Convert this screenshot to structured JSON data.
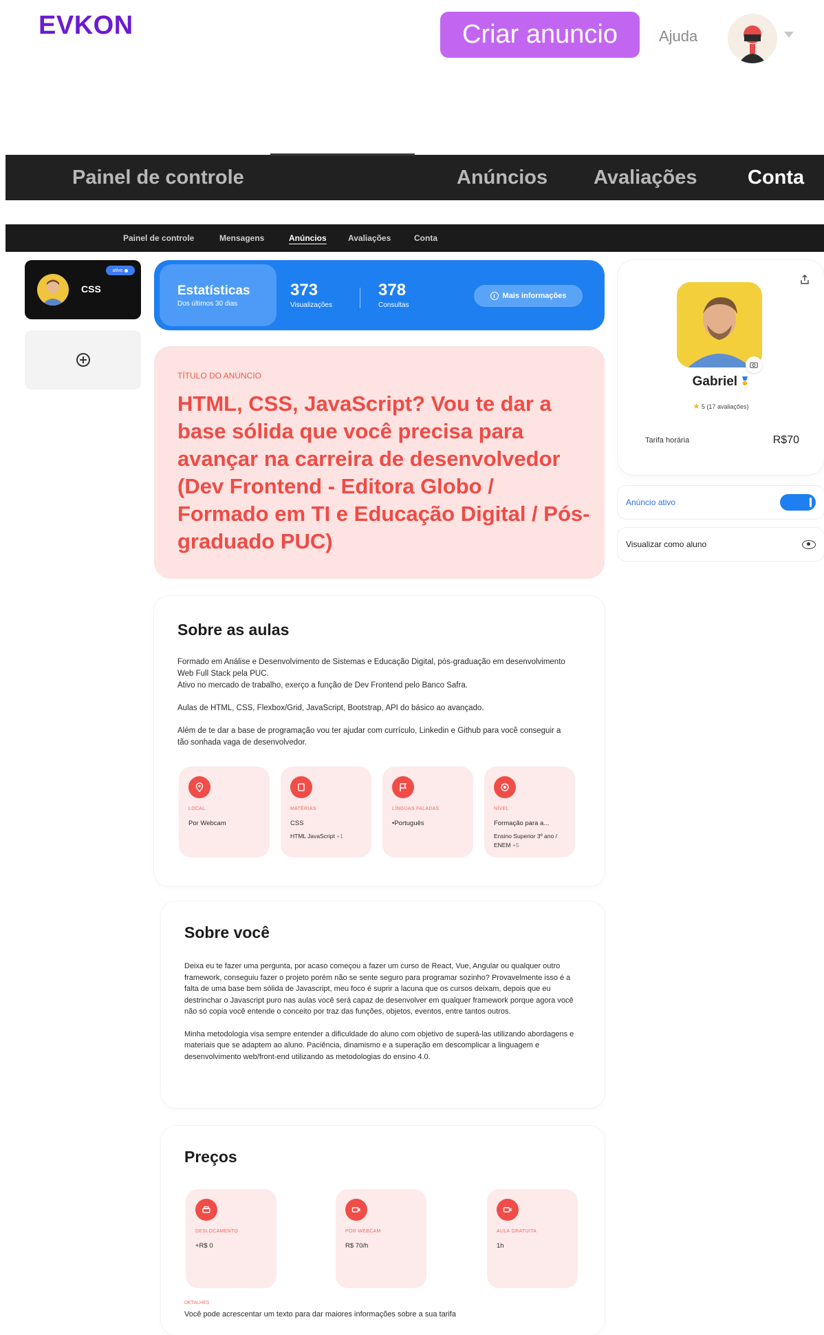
{
  "header": {
    "logo": "EVKON",
    "create_ad": "Criar anuncio",
    "help": "Ajuda"
  },
  "main_nav": {
    "items": [
      "Painel de controle",
      "Anúncios",
      "Avaliações",
      "Conta"
    ],
    "active": "Conta"
  },
  "sub_nav": {
    "items": [
      "Painel de controle",
      "Mensagens",
      "Anúncios",
      "Avaliações",
      "Conta"
    ],
    "active": "Anúncios"
  },
  "sidebar": {
    "ad_chip_label": "CSS",
    "ad_chip_badge": "ativo"
  },
  "stats": {
    "title": "Estatísticas",
    "subtitle": "Dos últimos 30 dias",
    "views_value": "373",
    "views_label": "Visualizações",
    "consults_value": "378",
    "consults_label": "Consultas",
    "more_info": "Mais informações"
  },
  "ad": {
    "kicker": "TÍTULO DO ANÚNCIO",
    "title": "HTML, CSS, JavaScript? Vou te dar a base sólida que você precisa para avançar na carreira de desenvolvedor (Dev Frontend - Editora Globo / Formado em TI e Educação Digital / Pós-graduado PUC)"
  },
  "about_classes": {
    "heading": "Sobre as aulas",
    "p1": "Formado em Análise e Desenvolvimento de Sistemas e Educação Digital, pós-graduação em desenvolvimento Web Full Stack pela PUC.",
    "p1b": "Ativo no mercado de trabalho, exerço a função de Dev Frontend pelo Banco Safra.",
    "p2": "Aulas de HTML, CSS, Flexbox/Grid, JavaScript, Bootstrap, API do básico ao avançado.",
    "p3": "Além de te dar a base de programação vou ter ajudar com currículo, Linkedin e Github para você conseguir a tão sonhada vaga de desenvolvedor.",
    "tiles": [
      {
        "caption": "LOCAL",
        "value": "Por Webcam",
        "value2": "",
        "more": ""
      },
      {
        "caption": "MATÉRIAS",
        "value": "CSS",
        "value2": "HTML JavaScript",
        "more": "+1"
      },
      {
        "caption": "LÍNGUAS FALADAS",
        "value": "•Português",
        "value2": "",
        "more": ""
      },
      {
        "caption": "NÍVEL",
        "value": "Formação para a...",
        "value2": "Ensino Superior 3º ano / ENEM",
        "more": "+5"
      }
    ]
  },
  "about_you": {
    "heading": "Sobre você",
    "p1": "Deixa eu te fazer uma pergunta, por acaso começou a fazer um curso de React, Vue, Angular ou qualquer outro framework, conseguiu fazer o projeto porém não se sente seguro para programar sozinho? Provavelmente isso é a falta de uma base bem sólida de Javascript, meu foco é suprir a lacuna que os cursos deixam, depois que eu destrinchar o Javascript puro nas aulas você será capaz de desenvolver em qualquer framework porque agora você não só copia você entende o conceito por traz das funções, objetos, eventos, entre tantos outros.",
    "p2": "Minha metodologia visa sempre entender a dificuldade do aluno com objetivo de superá-las utilizando abordagens e materiais que se adaptem ao aluno. Paciência, dinamismo e a superação em descomplicar a linguagem e desenvolvimento web/front-end utilizando as metodologias do ensino 4.0."
  },
  "prices": {
    "heading": "Preços",
    "tiles": [
      {
        "caption": "DESLOCAMENTO",
        "value": "+R$ 0"
      },
      {
        "caption": "POR WEBCAM",
        "value": "R$ 70/h"
      },
      {
        "caption": "AULA GRATUITA",
        "value": "1h"
      }
    ],
    "details_caption": "DETALHES",
    "details_text": "Você pode acrescentar um texto para dar maiores informações sobre a sua tarifa"
  },
  "profile": {
    "name": "Gabriel",
    "rating": "5",
    "reviews": "(17 avaliações)",
    "rate_label": "Tarifa horária",
    "rate_value": "R$70",
    "active_label": "Anúncio ativo",
    "view_as_student": "Visualizar como aluno"
  },
  "colors": {
    "brand": "#6b1bd1",
    "create_button": "#c266f2",
    "stats_blue": "#1e7ff0",
    "accent_red": "#ef4b45",
    "title_bg": "#fde3e2"
  }
}
